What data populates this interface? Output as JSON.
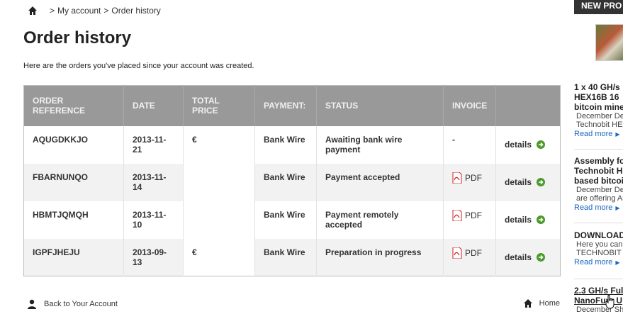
{
  "breadcrumb": {
    "home_icon": "home-icon",
    "separator": ">",
    "items": [
      "My account",
      "Order history"
    ]
  },
  "page": {
    "title": "Order history",
    "intro": "Here are the orders you've placed since your account was created."
  },
  "table": {
    "headers": {
      "order_reference": "ORDER REFERENCE",
      "date": "DATE",
      "total_price": "TOTAL PRICE",
      "payment": "PAYMENT:",
      "status": "STATUS",
      "invoice": "INVOICE",
      "actions": ""
    },
    "rows": [
      {
        "reference": "AQUGDKKJO",
        "date": "2013-11-21",
        "price": "€",
        "payment": "Bank Wire",
        "status": "Awaiting bank wire payment",
        "invoice": "-",
        "has_pdf": false,
        "details": "details"
      },
      {
        "reference": "FBARNUNQO",
        "date": "2013-11-14",
        "price": "",
        "payment": "Bank Wire",
        "status": "Payment accepted",
        "invoice": "PDF",
        "has_pdf": true,
        "details": "details"
      },
      {
        "reference": "HBMTJQMQH",
        "date": "2013-11-10",
        "price": "",
        "payment": "Bank Wire",
        "status": "Payment remotely accepted",
        "invoice": "PDF",
        "has_pdf": true,
        "details": "details"
      },
      {
        "reference": "IGPFJHEJU",
        "date": "2013-09-13",
        "price": "€",
        "payment": "Bank Wire",
        "status": "Preparation in progress",
        "invoice": "PDF",
        "has_pdf": true,
        "details": "details"
      }
    ]
  },
  "footer": {
    "back_label": "Back to Your Account",
    "home_label": "Home"
  },
  "sidebar": {
    "title": "NEW PRO",
    "items": [
      {
        "title_lines": [
          "1 x 40 GH/s",
          "HEX16B 16",
          "bitcoin mine"
        ],
        "desc_lines": [
          "December De",
          "Technobit HEX"
        ],
        "more": "Read more"
      },
      {
        "title_lines": [
          "Assembly fo",
          "Technobit H",
          "based bitcoi"
        ],
        "desc_lines": [
          "December De",
          "are offering As"
        ],
        "more": "Read more"
      },
      {
        "title_lines": [
          "DOWNLOAD"
        ],
        "desc_lines": [
          "Here you can",
          "TECHNOBIT"
        ],
        "more": "Read more"
      },
      {
        "title_lines": [
          "2.3 GH/s Ful",
          "NanoFury U"
        ],
        "desc_lines": [
          "December Sh"
        ],
        "more": ""
      }
    ]
  },
  "colors": {
    "header_bg": "#999999",
    "sidebar_title_bg": "#333333",
    "link_blue": "#1a66c0",
    "details_green": "#4a9a2a",
    "pdf_red": "#cc2222"
  }
}
